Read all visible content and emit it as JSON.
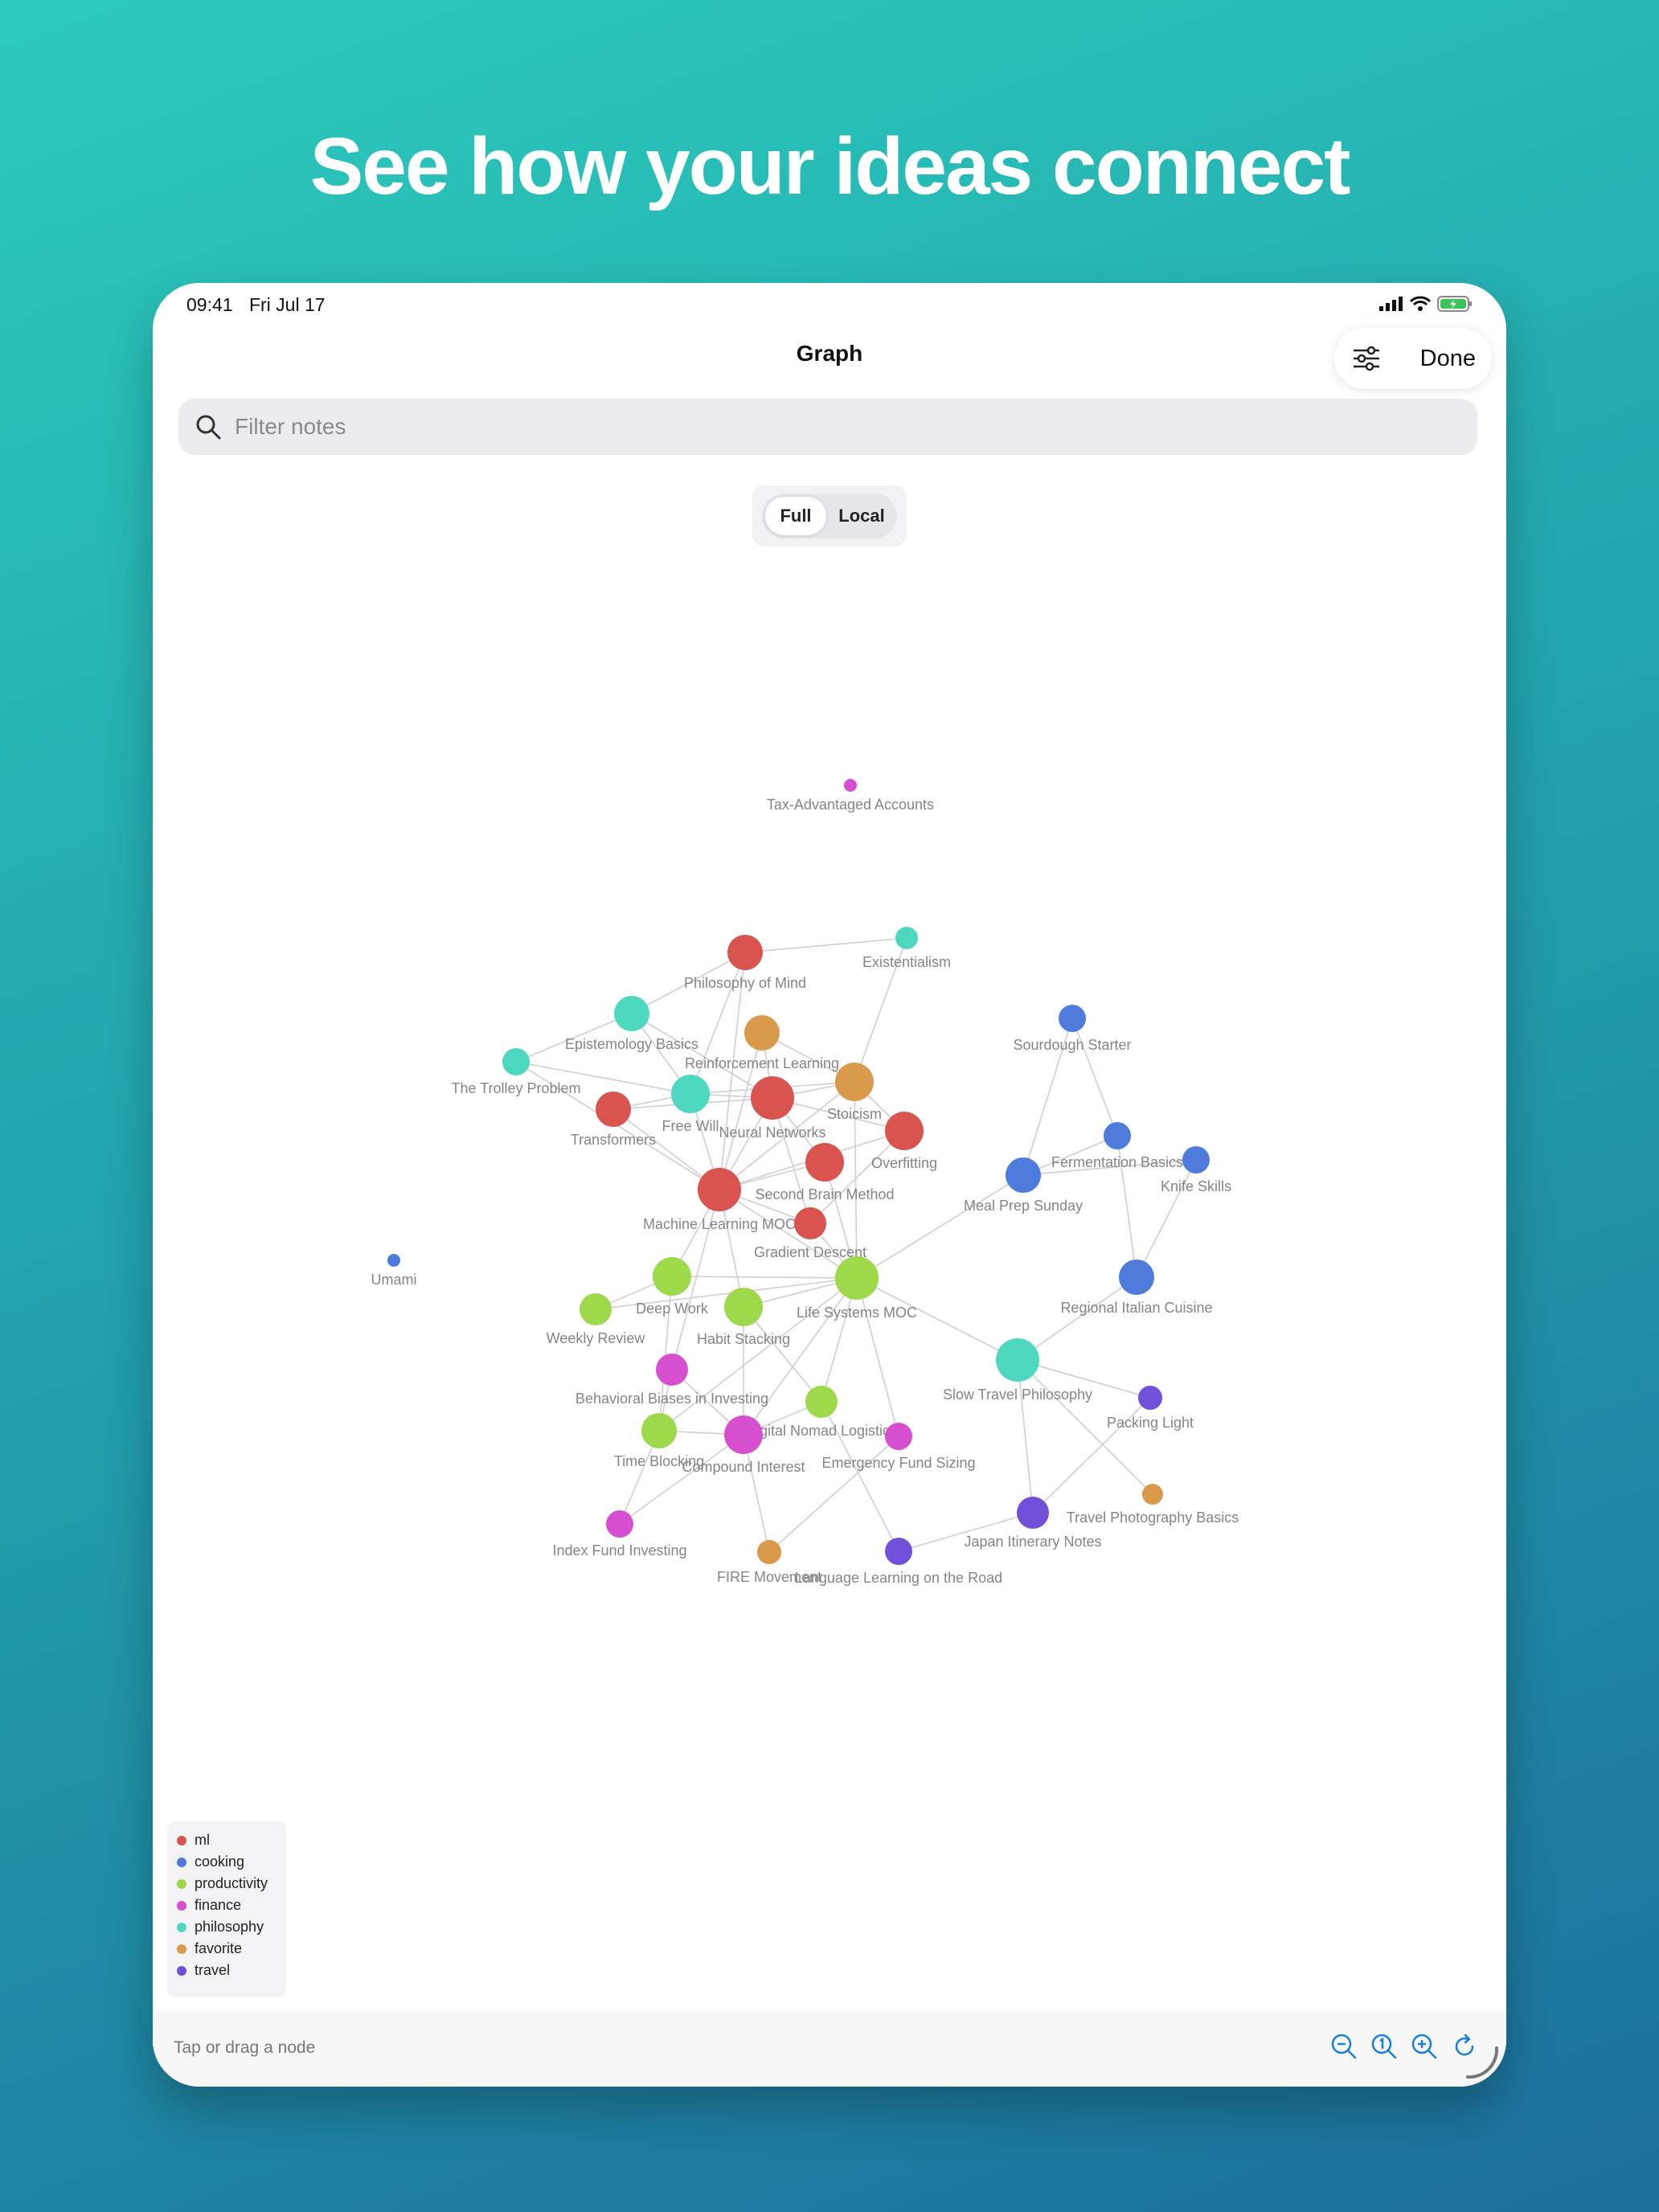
{
  "headline": "See how your ideas connect",
  "status": {
    "time": "09:41",
    "date": "Fri Jul 17"
  },
  "nav": {
    "title": "Graph",
    "done_label": "Done",
    "settings_icon": "sliders-icon"
  },
  "search": {
    "placeholder": "Filter notes",
    "value": ""
  },
  "segment": {
    "options": [
      "Full",
      "Local"
    ],
    "selected": "Full"
  },
  "colors": {
    "ml": "#d9534f",
    "cooking": "#4f7bdc",
    "productivity": "#9ed84b",
    "finance": "#d64fcf",
    "philosophy": "#4fd8c0",
    "favorite": "#d99a4b",
    "travel": "#7050d8"
  },
  "legend": [
    {
      "label": "ml",
      "color": "#d9534f"
    },
    {
      "label": "cooking",
      "color": "#4f7bdc"
    },
    {
      "label": "productivity",
      "color": "#9ed84b"
    },
    {
      "label": "finance",
      "color": "#d64fcf"
    },
    {
      "label": "philosophy",
      "color": "#4fd8c0"
    },
    {
      "label": "favorite",
      "color": "#d99a4b"
    },
    {
      "label": "travel",
      "color": "#7050d8"
    }
  ],
  "graph": {
    "nodes": [
      {
        "label": "Tax-Advantaged Accounts",
        "tag": "finance"
      },
      {
        "label": "Philosophy of Mind",
        "tag": "ml"
      },
      {
        "label": "Existentialism",
        "tag": "philosophy"
      },
      {
        "label": "Epistemology Basics",
        "tag": "philosophy"
      },
      {
        "label": "Reinforcement Learning",
        "tag": "favorite"
      },
      {
        "label": "The Trolley Problem",
        "tag": "philosophy"
      },
      {
        "label": "Free Will",
        "tag": "philosophy"
      },
      {
        "label": "Neural Networks",
        "tag": "ml"
      },
      {
        "label": "Stoicism",
        "tag": "favorite"
      },
      {
        "label": "Transformers",
        "tag": "ml"
      },
      {
        "label": "Overfitting",
        "tag": "ml"
      },
      {
        "label": "Second Brain Method",
        "tag": "ml"
      },
      {
        "label": "Machine Learning MOC",
        "tag": "ml"
      },
      {
        "label": "Gradient Descent",
        "tag": "ml"
      },
      {
        "label": "Deep Work",
        "tag": "productivity"
      },
      {
        "label": "Life Systems MOC",
        "tag": "productivity"
      },
      {
        "label": "Weekly Review",
        "tag": "productivity"
      },
      {
        "label": "Habit Stacking",
        "tag": "productivity"
      },
      {
        "label": "Behavioral Biases in Investing",
        "tag": "finance"
      },
      {
        "label": "Digital Nomad Logistics",
        "tag": "productivity"
      },
      {
        "label": "Time Blocking",
        "tag": "productivity"
      },
      {
        "label": "Compound Interest",
        "tag": "finance"
      },
      {
        "label": "Emergency Fund Sizing",
        "tag": "finance"
      },
      {
        "label": "Index Fund Investing",
        "tag": "finance"
      },
      {
        "label": "FIRE Movement",
        "tag": "favorite"
      },
      {
        "label": "Language Learning on the Road",
        "tag": "travel"
      },
      {
        "label": "Japan Itinerary Notes",
        "tag": "travel"
      },
      {
        "label": "Travel Photography Basics",
        "tag": "favorite"
      },
      {
        "label": "Packing Light",
        "tag": "travel"
      },
      {
        "label": "Slow Travel Philosophy",
        "tag": "philosophy"
      },
      {
        "label": "Regional Italian Cuisine",
        "tag": "cooking"
      },
      {
        "label": "Meal Prep Sunday",
        "tag": "cooking"
      },
      {
        "label": "Fermentation Basics",
        "tag": "cooking"
      },
      {
        "label": "Knife Skills",
        "tag": "cooking"
      },
      {
        "label": "Sourdough Starter",
        "tag": "cooking"
      },
      {
        "label": "Umami",
        "tag": "cooking"
      }
    ],
    "edges": [
      [
        "Philosophy of Mind",
        "Existentialism"
      ],
      [
        "Philosophy of Mind",
        "Epistemology Basics"
      ],
      [
        "Philosophy of Mind",
        "Free Will"
      ],
      [
        "Philosophy of Mind",
        "Machine Learning MOC"
      ],
      [
        "Existentialism",
        "Stoicism"
      ],
      [
        "Epistemology Basics",
        "The Trolley Problem"
      ],
      [
        "Epistemology Basics",
        "Free Will"
      ],
      [
        "Epistemology Basics",
        "Neural Networks"
      ],
      [
        "The Trolley Problem",
        "Free Will"
      ],
      [
        "The Trolley Problem",
        "Machine Learning MOC"
      ],
      [
        "Reinforcement Learning",
        "Neural Networks"
      ],
      [
        "Reinforcement Learning",
        "Machine Learning MOC"
      ],
      [
        "Reinforcement Learning",
        "Stoicism"
      ],
      [
        "Free Will",
        "Neural Networks"
      ],
      [
        "Free Will",
        "Transformers"
      ],
      [
        "Free Will",
        "Machine Learning MOC"
      ],
      [
        "Free Will",
        "Stoicism"
      ],
      [
        "Neural Networks",
        "Stoicism"
      ],
      [
        "Neural Networks",
        "Machine Learning MOC"
      ],
      [
        "Neural Networks",
        "Transformers"
      ],
      [
        "Neural Networks",
        "Gradient Descent"
      ],
      [
        "Neural Networks",
        "Overfitting"
      ],
      [
        "Neural Networks",
        "Second Brain Method"
      ],
      [
        "Stoicism",
        "Machine Learning MOC"
      ],
      [
        "Stoicism",
        "Life Systems MOC"
      ],
      [
        "Stoicism",
        "Overfitting"
      ],
      [
        "Transformers",
        "Machine Learning MOC"
      ],
      [
        "Overfitting",
        "Machine Learning MOC"
      ],
      [
        "Overfitting",
        "Gradient Descent"
      ],
      [
        "Second Brain Method",
        "Machine Learning MOC"
      ],
      [
        "Second Brain Method",
        "Life Systems MOC"
      ],
      [
        "Machine Learning MOC",
        "Gradient Descent"
      ],
      [
        "Machine Learning MOC",
        "Deep Work"
      ],
      [
        "Machine Learning MOC",
        "Habit Stacking"
      ],
      [
        "Machine Learning MOC",
        "Behavioral Biases in Investing"
      ],
      [
        "Machine Learning MOC",
        "Life Systems MOC"
      ],
      [
        "Gradient Descent",
        "Life Systems MOC"
      ],
      [
        "Life Systems MOC",
        "Deep Work"
      ],
      [
        "Life Systems MOC",
        "Weekly Review"
      ],
      [
        "Life Systems MOC",
        "Habit Stacking"
      ],
      [
        "Life Systems MOC",
        "Time Blocking"
      ],
      [
        "Life Systems MOC",
        "Digital Nomad Logistics"
      ],
      [
        "Life Systems MOC",
        "Emergency Fund Sizing"
      ],
      [
        "Life Systems MOC",
        "Meal Prep Sunday"
      ],
      [
        "Life Systems MOC",
        "Slow Travel Philosophy"
      ],
      [
        "Life Systems MOC",
        "Compound Interest"
      ],
      [
        "Deep Work",
        "Weekly Review"
      ],
      [
        "Deep Work",
        "Time Blocking"
      ],
      [
        "Habit Stacking",
        "Digital Nomad Logistics"
      ],
      [
        "Habit Stacking",
        "Compound Interest"
      ],
      [
        "Behavioral Biases in Investing",
        "Compound Interest"
      ],
      [
        "Behavioral Biases in Investing",
        "Time Blocking"
      ],
      [
        "Compound Interest",
        "Index Fund Investing"
      ],
      [
        "Compound Interest",
        "FIRE Movement"
      ],
      [
        "Compound Interest",
        "Time Blocking"
      ],
      [
        "Digital Nomad Logistics",
        "Compound Interest"
      ],
      [
        "Digital Nomad Logistics",
        "Language Learning on the Road"
      ],
      [
        "Time Blocking",
        "Index Fund Investing"
      ],
      [
        "Emergency Fund Sizing",
        "FIRE Movement"
      ],
      [
        "Japan Itinerary Notes",
        "Language Learning on the Road"
      ],
      [
        "Japan Itinerary Notes",
        "Packing Light"
      ],
      [
        "Japan Itinerary Notes",
        "Slow Travel Philosophy"
      ],
      [
        "Slow Travel Philosophy",
        "Packing Light"
      ],
      [
        "Slow Travel Philosophy",
        "Travel Photography Basics"
      ],
      [
        "Slow Travel Philosophy",
        "Regional Italian Cuisine"
      ],
      [
        "Regional Italian Cuisine",
        "Fermentation Basics"
      ],
      [
        "Regional Italian Cuisine",
        "Knife Skills"
      ],
      [
        "Meal Prep Sunday",
        "Sourdough Starter"
      ],
      [
        "Meal Prep Sunday",
        "Fermentation Basics"
      ],
      [
        "Sourdough Starter",
        "Fermentation Basics"
      ],
      [
        "Meal Prep Sunday",
        "Knife Skills"
      ]
    ]
  },
  "bottom": {
    "hint": "Tap or drag a node",
    "tools": [
      "zoom-out-icon",
      "zoom-reset-icon",
      "zoom-in-icon",
      "refresh-icon"
    ]
  }
}
